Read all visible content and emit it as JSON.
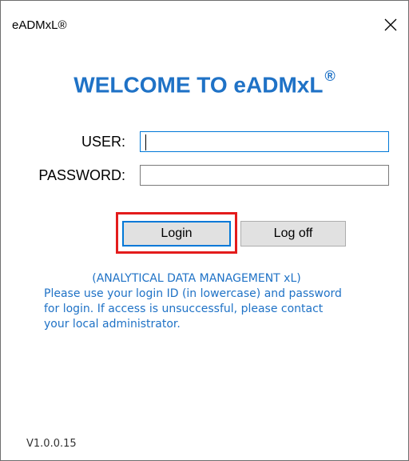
{
  "window": {
    "title": "eADMxL®",
    "close_icon": "close-icon"
  },
  "welcome": {
    "text": "WELCOME TO eADMxL",
    "registered_mark": "®"
  },
  "form": {
    "user_label": "USER:",
    "user_value": "",
    "password_label": "PASSWORD:",
    "password_value": ""
  },
  "buttons": {
    "login_label": "Login",
    "logoff_label": "Log off"
  },
  "info": {
    "line1": "(ANALYTICAL DATA MANAGEMENT xL)",
    "line2": "Please use your login ID (in lowercase) and password",
    "line3": "for login.  If access is unsuccessful, please contact",
    "line4": "your local administrator."
  },
  "version": "V1.0.0.15",
  "colors": {
    "accent_blue": "#1f72c6",
    "highlight_red": "#e31c1c",
    "focus_blue": "#0078d7"
  }
}
